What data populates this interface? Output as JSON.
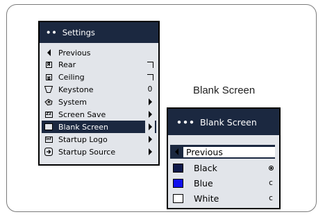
{
  "settings_menu": {
    "title": "Settings",
    "items": [
      {
        "label": "Previous",
        "icon": "back-arrow-icon",
        "control": "none"
      },
      {
        "label": "Rear",
        "icon": "rear-projection-icon",
        "control": "checkbox"
      },
      {
        "label": "Ceiling",
        "icon": "ceiling-mount-icon",
        "control": "checkbox"
      },
      {
        "label": "Keystone",
        "icon": "keystone-icon",
        "control": "value",
        "value": "0"
      },
      {
        "label": "System",
        "icon": "system-icon",
        "control": "submenu"
      },
      {
        "label": "Screen Save",
        "icon": "screen-save-icon",
        "control": "submenu"
      },
      {
        "label": "Blank Screen",
        "icon": "blank-screen-icon",
        "control": "submenu",
        "selected": true
      },
      {
        "label": "Startup Logo",
        "icon": "startup-logo-icon",
        "control": "submenu"
      },
      {
        "label": "Startup Source",
        "icon": "startup-source-icon",
        "control": "submenu"
      }
    ],
    "icon_glyphs": {
      "rear": "Я",
      "ceiling": "Я",
      "screen_save": "Zz",
      "startup_logo": "inf"
    }
  },
  "caption": "Blank Screen",
  "blank_screen_menu": {
    "title": "Blank Screen",
    "items": [
      {
        "label": "Previous",
        "icon": "back-arrow-icon",
        "selected": true
      },
      {
        "label": "Black",
        "swatch": "#0f1a4a",
        "radio": "selected"
      },
      {
        "label": "Blue",
        "swatch": "#1010ee",
        "radio": "unselected"
      },
      {
        "label": "White",
        "swatch": "#ffffff",
        "radio": "unselected"
      }
    ]
  },
  "colors": {
    "header": "#1b2840",
    "panel_bg": "#e2e5ea",
    "selected_bg": "#1b2840"
  }
}
